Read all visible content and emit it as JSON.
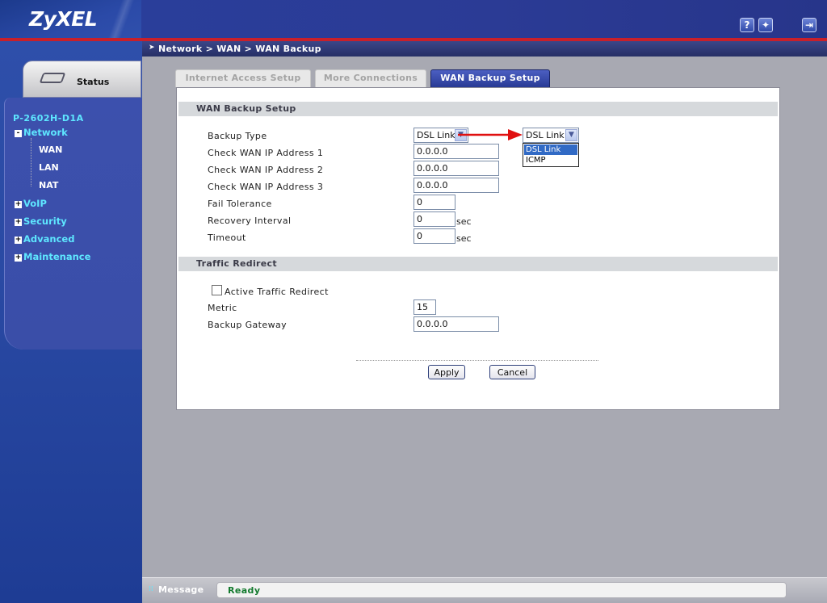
{
  "app": {
    "brand": "ZyXEL"
  },
  "top_icons": {
    "help": "?",
    "wizard": "✦",
    "logout": "⇥"
  },
  "sidebar": {
    "status_label": "Status",
    "device_name": "P-2602H-D1A",
    "items": [
      {
        "label": "Network",
        "toggle": "-",
        "expanded": true,
        "children": [
          {
            "label": "WAN"
          },
          {
            "label": "LAN"
          },
          {
            "label": "NAT"
          }
        ]
      },
      {
        "label": "VoIP",
        "toggle": "+"
      },
      {
        "label": "Security",
        "toggle": "+"
      },
      {
        "label": "Advanced",
        "toggle": "+"
      },
      {
        "label": "Maintenance",
        "toggle": "+"
      }
    ]
  },
  "breadcrumb": "Network > WAN > WAN Backup",
  "tabs": [
    {
      "label": "Internet Access Setup",
      "active": false
    },
    {
      "label": "More Connections",
      "active": false
    },
    {
      "label": "WAN Backup Setup",
      "active": true
    }
  ],
  "wan_backup": {
    "title": "WAN Backup Setup",
    "backup_type_label": "Backup Type",
    "backup_type_value": "DSL Link",
    "dropdown_options": [
      "DSL Link",
      "ICMP"
    ],
    "dropdown_selected": "DSL Link",
    "check_ip_1_label": "Check WAN IP Address  1",
    "check_ip_1_value": "0.0.0.0",
    "check_ip_2_label": "Check WAN IP Address  2",
    "check_ip_2_value": "0.0.0.0",
    "check_ip_3_label": "Check WAN IP Address  3",
    "check_ip_3_value": "0.0.0.0",
    "fail_tolerance_label": "Fail Tolerance",
    "fail_tolerance_value": "0",
    "recovery_interval_label": "Recovery Interval",
    "recovery_interval_value": "0",
    "recovery_interval_unit": "sec",
    "timeout_label": "Timeout",
    "timeout_value": "0",
    "timeout_unit": "sec"
  },
  "traffic_redirect": {
    "title": "Traffic Redirect",
    "active_label": "Active Traffic Redirect",
    "active_checked": false,
    "metric_label": "Metric",
    "metric_value": "15",
    "gateway_label": "Backup Gateway",
    "gateway_value": "0.0.0.0"
  },
  "buttons": {
    "apply": "Apply",
    "cancel": "Cancel"
  },
  "status_bar": {
    "label": "Message",
    "text": "Ready"
  },
  "colors": {
    "accent_red": "#c8202a",
    "link_cyan": "#5ee7ff",
    "ready_green": "#137a2e",
    "selection_blue": "#316ac5"
  }
}
